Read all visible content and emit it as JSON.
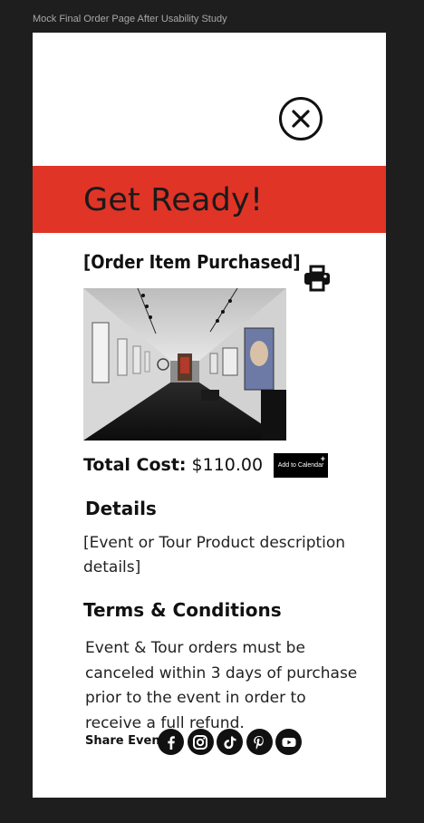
{
  "frame_label": "Mock Final Order Page After Usability Study",
  "banner": {
    "title": "Get Ready!"
  },
  "order": {
    "item_title": "[Order Item Purchased]",
    "total_label": "Total Cost:",
    "total_value": "$110.00",
    "calendar_button": "Add to Calendar",
    "calendar_plus": "+"
  },
  "details": {
    "heading": "Details",
    "text": "[Event or Tour Product description details]"
  },
  "terms": {
    "heading": "Terms & Conditions",
    "text": "Event & Tour orders must be canceled within 3 days of purchase prior to the event in order to receive a full refund."
  },
  "share": {
    "label": "Share Event",
    "icons": [
      "facebook-icon",
      "instagram-icon",
      "tiktok-icon",
      "pinterest-icon",
      "youtube-icon"
    ]
  },
  "colors": {
    "banner": "#e03427",
    "page": "#ffffff",
    "canvas": "#1e1e1e",
    "text": "#111111"
  }
}
